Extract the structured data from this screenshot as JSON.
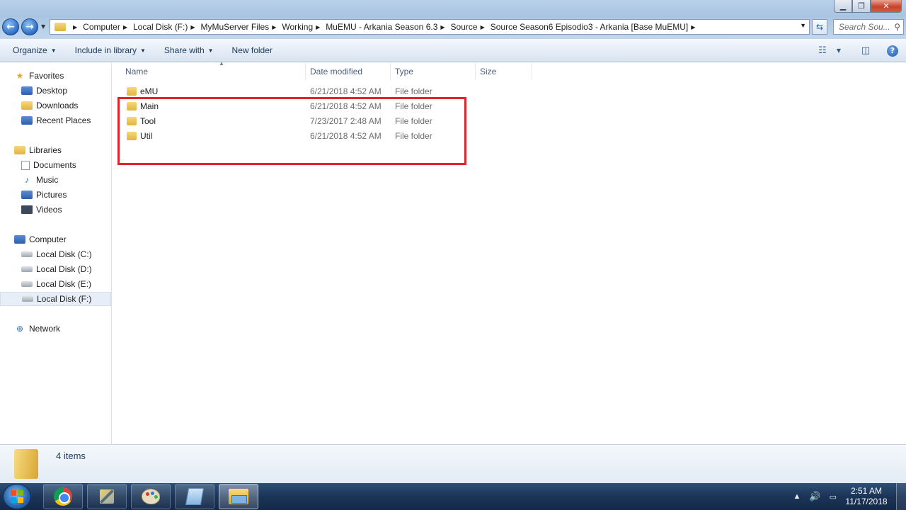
{
  "window": {
    "minimize_glyph": "▁",
    "maximize_glyph": "❐",
    "close_glyph": "✕"
  },
  "address": {
    "crumbs": [
      "Computer",
      "Local Disk (F:)",
      "MyMuServer Files",
      "Working",
      "MuEMU - Arkania Season 6.3",
      "Source",
      "Source Season6 Episodio3 - Arkania [Base MuEMU]"
    ],
    "search_placeholder": "Search Sou..."
  },
  "toolbar": {
    "organize": "Organize",
    "include_in_library": "Include in library",
    "share_with": "Share with",
    "new_folder": "New folder"
  },
  "nav": {
    "favorites": "Favorites",
    "desktop": "Desktop",
    "downloads": "Downloads",
    "recent_places": "Recent Places",
    "libraries": "Libraries",
    "documents": "Documents",
    "music": "Music",
    "pictures": "Pictures",
    "videos": "Videos",
    "computer": "Computer",
    "drive_c": "Local Disk (C:)",
    "drive_d": "Local Disk (D:)",
    "drive_e": "Local Disk (E:)",
    "drive_f": "Local Disk (F:)",
    "network": "Network"
  },
  "columns": {
    "name": "Name",
    "date_modified": "Date modified",
    "type": "Type",
    "size": "Size"
  },
  "files": [
    {
      "name": "eMU",
      "date": "6/21/2018 4:52 AM",
      "type": "File folder"
    },
    {
      "name": "Main",
      "date": "6/21/2018 4:52 AM",
      "type": "File folder"
    },
    {
      "name": "Tool",
      "date": "7/23/2017 2:48 AM",
      "type": "File folder"
    },
    {
      "name": "Util",
      "date": "6/21/2018 4:52 AM",
      "type": "File folder"
    }
  ],
  "highlight_color": "#e0242c",
  "details": {
    "item_count": "4 items"
  },
  "taskbar": {
    "time": "2:51 AM",
    "date": "11/17/2018"
  }
}
